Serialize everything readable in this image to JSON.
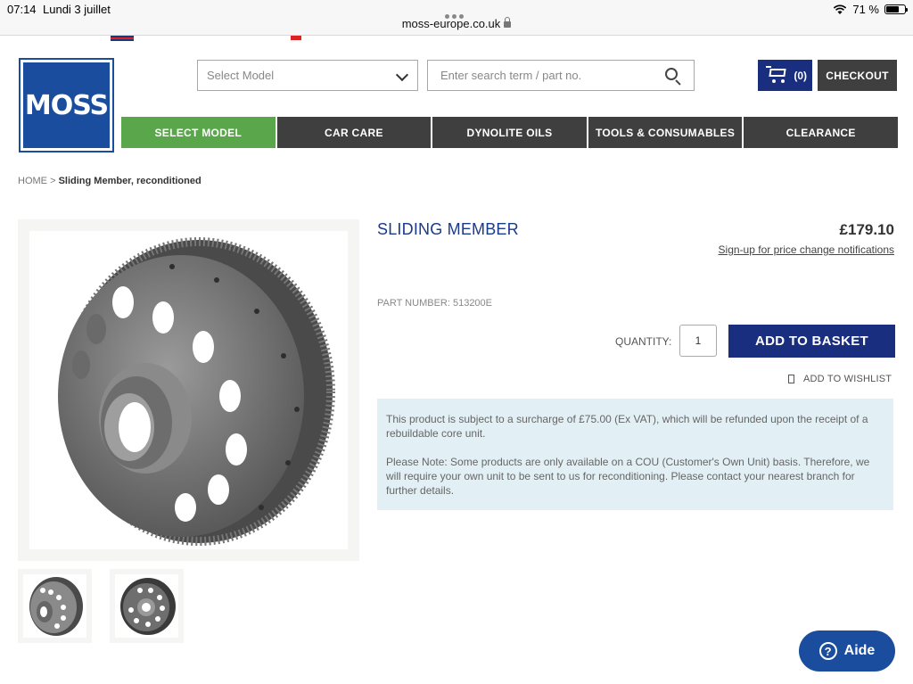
{
  "status_bar": {
    "time": "07:14",
    "date": "Lundi 3 juillet",
    "url": "moss-europe.co.uk",
    "battery": "71 %",
    "battery_level": 0.71
  },
  "header": {
    "logo_text": "MOSS",
    "select_model_placeholder": "Select Model",
    "search_placeholder": "Enter search term / part no.",
    "cart_count": "(0)",
    "checkout_label": "CHECKOUT"
  },
  "nav": {
    "items": [
      {
        "label": "SELECT MODEL"
      },
      {
        "label": "CAR CARE"
      },
      {
        "label": "DYNOLITE OILS"
      },
      {
        "label": "TOOLS & CONSUMABLES"
      },
      {
        "label": "CLEARANCE"
      }
    ]
  },
  "breadcrumb": {
    "home": "HOME",
    "separator": ">",
    "current": "Sliding Member, reconditioned"
  },
  "product": {
    "title": "SLIDING MEMBER",
    "price": "£179.10",
    "price_alert_link": "Sign-up for price change notifications",
    "part_number": "PART NUMBER: 513200E",
    "quantity_label": "QUANTITY:",
    "quantity_value": "1",
    "add_to_basket": "ADD TO BASKET",
    "wishlist": "ADD TO WISHLIST",
    "notice_1": "This product is subject to a surcharge of £75.00 (Ex VAT), which will be refunded upon the receipt of a rebuildable core unit.",
    "notice_2": "Please Note: Some products are only available on a COU (Customer's Own Unit) basis. Therefore, we will require your own unit to be sent to us for reconditioning. Please contact your nearest branch for further details."
  },
  "help": {
    "label": "Aide",
    "icon": "?"
  },
  "colors": {
    "brand_blue": "#1a4d9e",
    "navy": "#1a2e80",
    "nav_dark": "#3f3f3f",
    "nav_active_green": "#5aa64a",
    "notice_bg": "#e2eff5"
  }
}
